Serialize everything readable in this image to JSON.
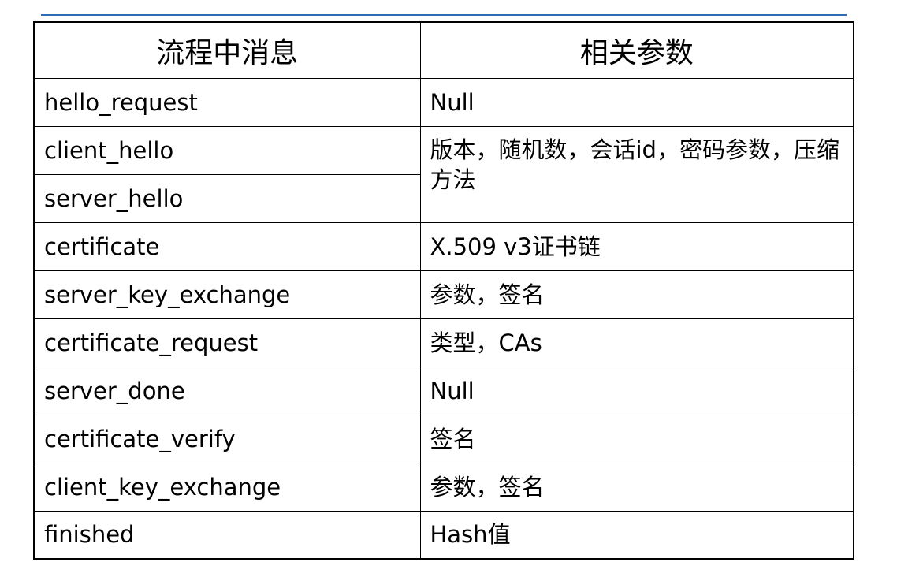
{
  "colors": {
    "top_rule": "#2e6db4",
    "border": "#000000",
    "text": "#000000"
  },
  "table": {
    "headers": [
      "流程中消息",
      "相关参数"
    ],
    "rows": [
      {
        "message": "hello_request",
        "params": "Null"
      },
      {
        "message": "client_hello",
        "params": "版本，随机数，会话id，密码参数，压缩方法"
      },
      {
        "message": "server_hello",
        "params": ""
      },
      {
        "message": "certificate",
        "params": "X.509 v3证书链"
      },
      {
        "message": "server_key_exchange",
        "params": "参数，签名"
      },
      {
        "message": "certificate_request",
        "params": "类型，CAs"
      },
      {
        "message": "server_done",
        "params": "Null"
      },
      {
        "message": "certificate_verify",
        "params": "签名"
      },
      {
        "message": "client_key_exchange",
        "params": "参数，签名"
      },
      {
        "message": "finished",
        "params": "Hash值"
      }
    ]
  }
}
